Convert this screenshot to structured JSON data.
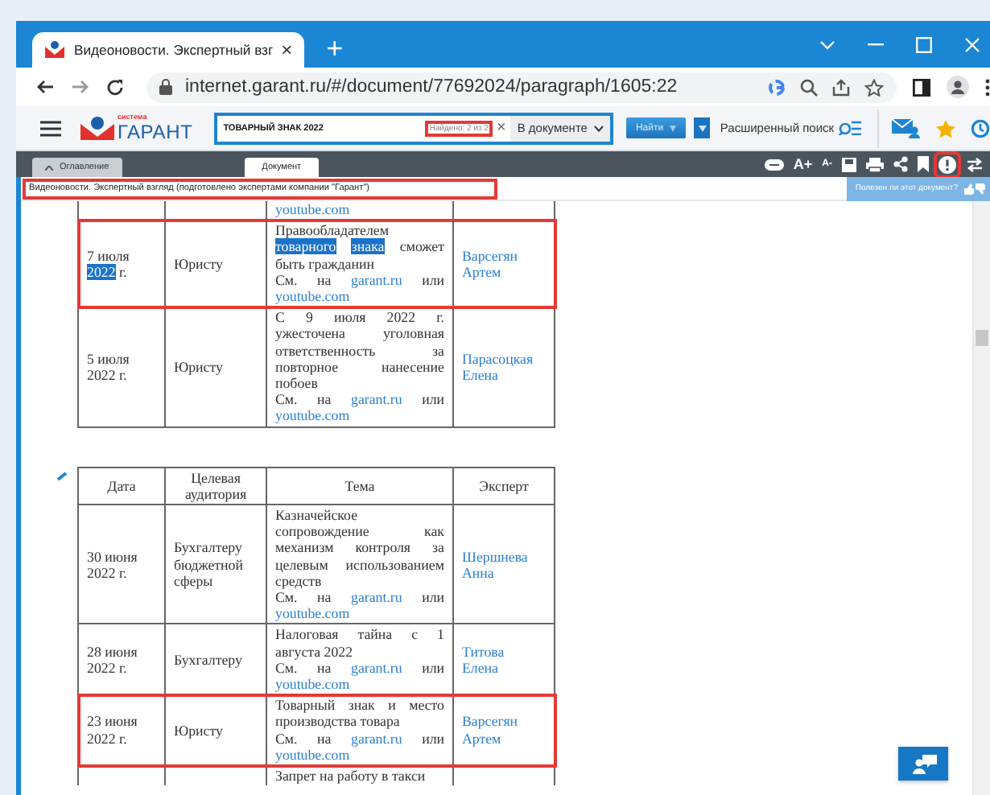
{
  "browser": {
    "tab_title": "Видеоновости. Экспертный взг",
    "tab_close": "×",
    "new_tab": "+",
    "url": "internet.garant.ru/#/document/77692024/paragraph/1605:22"
  },
  "app_toolbar": {
    "logo_caption": "система",
    "logo": "ГАРАНТ",
    "search_value": "ТОВАРНЫЙ ЗНАК 2022",
    "found": "Найдено: 2 из 2",
    "found_marked": true,
    "clear": "×",
    "scope": "В документе",
    "find_button": "Найти",
    "advanced_search": "Расширенный поиск"
  },
  "doc_tabs": [
    {
      "label": "Оглавление",
      "selected": false
    },
    {
      "label": "Документ",
      "selected": true
    }
  ],
  "doc_tools": {
    "font_increase": "A+",
    "font_decrease": "A-",
    "alert_marked": true
  },
  "document_title": {
    "text": "Видеоновости. Экспертный взгляд (подготовлено экспертами компании \"Гарант\")",
    "marked": true
  },
  "feedback": "Полезен ли этот документ?",
  "tables": [
    {
      "rows": [
        {
          "kind": "cut_top",
          "link2": "youtube.com",
          "marked": false
        },
        {
          "kind": "full",
          "marked": true,
          "date": [
            {
              "text": "7 июля",
              "highlighted": false
            },
            {
              "text": "2022",
              "highlighted": true
            },
            {
              "text": "г.",
              "highlighted": false
            }
          ],
          "audience": "Юристу",
          "topic": [
            {
              "text": "Правообладателем",
              "highlighted": false
            },
            {
              "text": "товарного",
              "highlighted": true
            },
            {
              "text": "знака",
              "highlighted": true
            },
            {
              "text": "сможет быть гражданин",
              "highlighted": false
            }
          ],
          "see": "См. на",
          "link1": "garant.ru",
          "or": "или",
          "link2": "youtube.com",
          "expert": "Варсегян Артем"
        },
        {
          "kind": "full",
          "marked": false,
          "date": [
            {
              "text": "5 июля 2022 г.",
              "highlighted": false
            }
          ],
          "audience": "Юристу",
          "topic": [
            {
              "text": "С 9 июля 2022 г. ужесточена уголовная ответственность за повторное нанесение побоев",
              "highlighted": false
            }
          ],
          "see": "См. на",
          "link1": "garant.ru",
          "or": "или",
          "link2": "youtube.com",
          "expert": "Парасоцкая Елена"
        }
      ]
    },
    {
      "columns": [
        "Дата",
        "Целевая аудитория",
        "Тема",
        "Эксперт"
      ],
      "rows": [
        {
          "kind": "full",
          "marked": false,
          "date": [
            {
              "text": "30 июня 2022 г.",
              "highlighted": false
            }
          ],
          "audience": "Бухгалтеру бюджетной сферы",
          "topic": [
            {
              "text": "Казначейское сопровождение как механизм контроля за целевым использованием средств",
              "highlighted": false
            }
          ],
          "see": "См. на",
          "link1": "garant.ru",
          "or": "или",
          "link2": "youtube.com",
          "expert": "Шершнева Анна"
        },
        {
          "kind": "full",
          "marked": false,
          "date": [
            {
              "text": "28 июня 2022 г.",
              "highlighted": false
            }
          ],
          "audience": "Бухгалтеру",
          "topic": [
            {
              "text": "Налоговая тайна с 1 августа 2022",
              "highlighted": false
            }
          ],
          "see": "См. на",
          "link1": "garant.ru",
          "or": "или",
          "link2": "youtube.com",
          "expert": "Титова Елена"
        },
        {
          "kind": "full",
          "marked": true,
          "date": [
            {
              "text": "23 июня 2022 г.",
              "highlighted": false
            }
          ],
          "audience": "Юристу",
          "topic": [
            {
              "text": "Товарный знак и место производства товара",
              "highlighted": false
            }
          ],
          "see": "См. на",
          "link1": "garant.ru",
          "or": "или",
          "link2": "youtube.com",
          "expert": "Варсегян Артем"
        },
        {
          "kind": "cut_bottom",
          "marked": false,
          "topic": [
            {
              "text": "Запрет на работу в такси",
              "highlighted": false
            }
          ]
        }
      ]
    }
  ]
}
